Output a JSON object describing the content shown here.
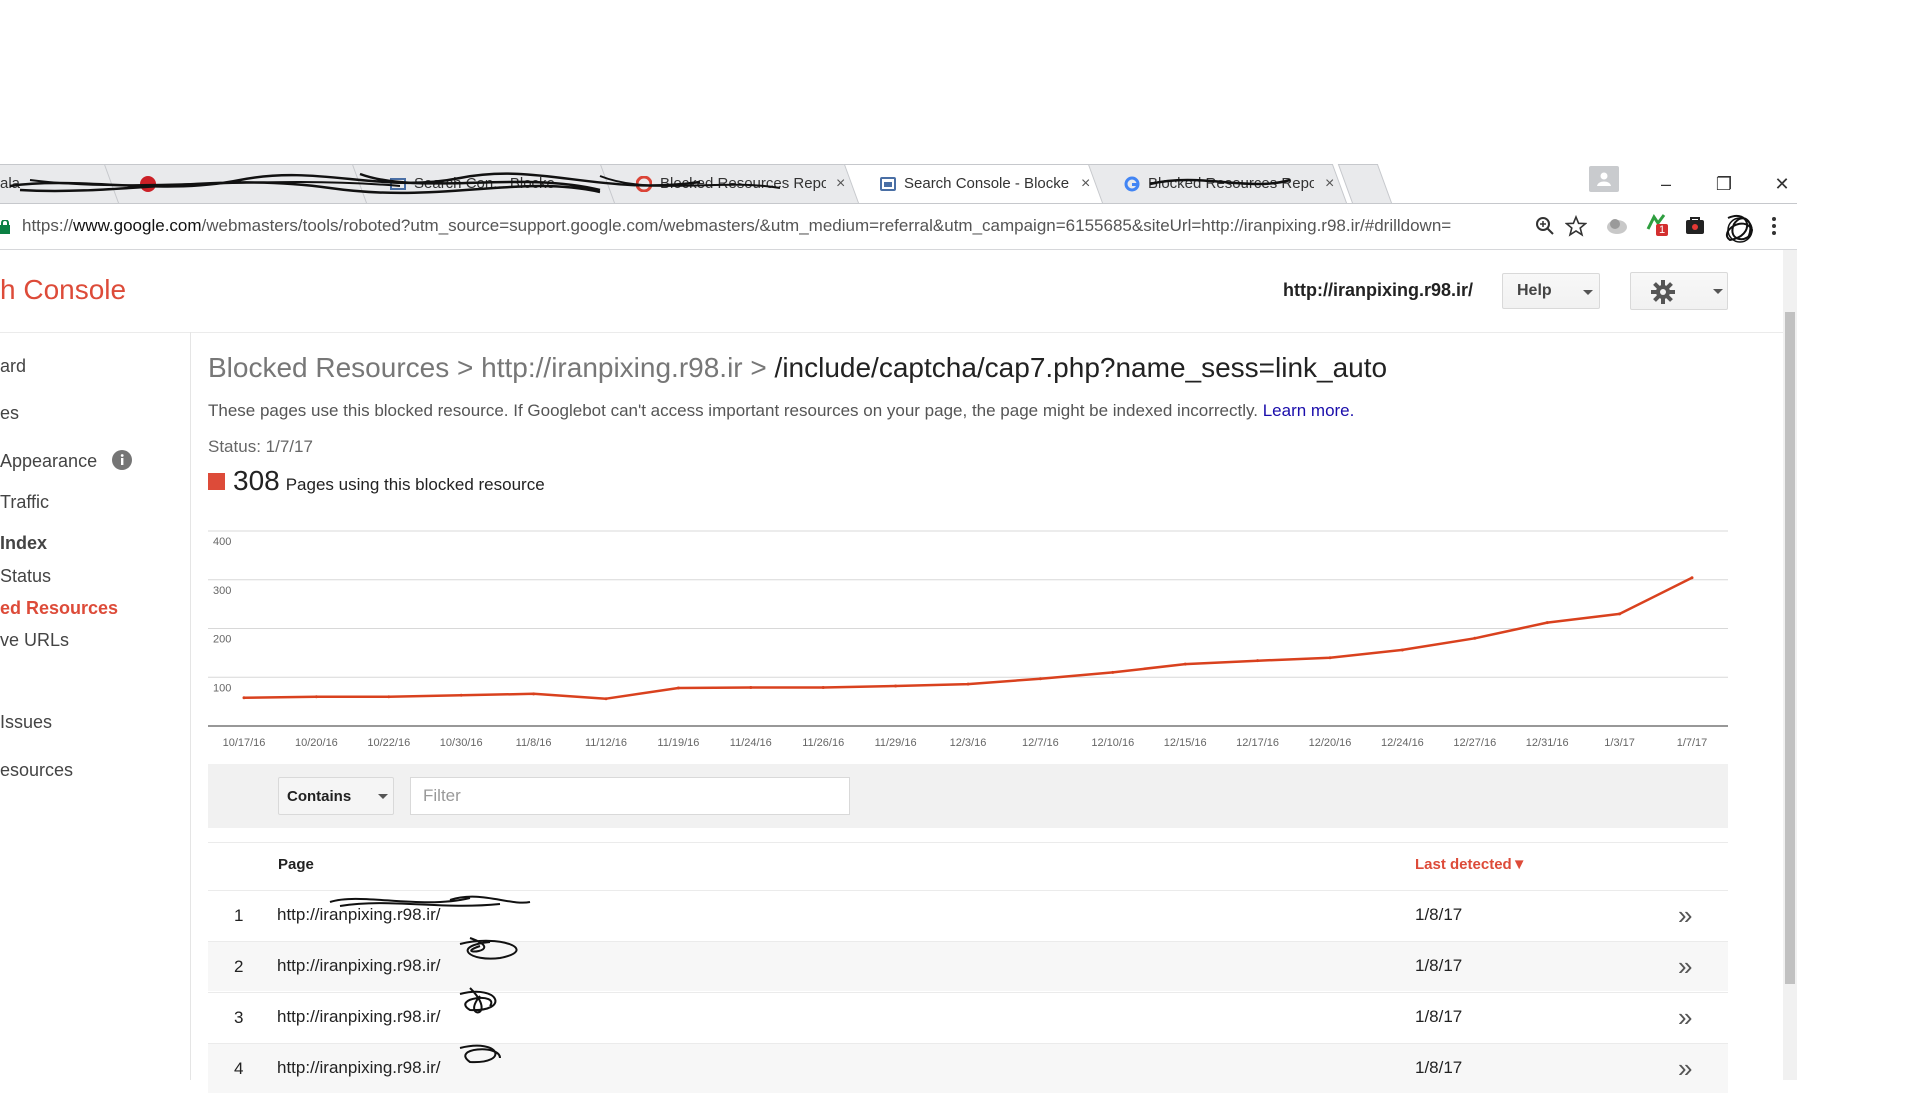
{
  "browser": {
    "tabs": [
      {
        "title": "ala",
        "close": "×"
      },
      {
        "title": "",
        "close": "×"
      },
      {
        "title": "Search Con... Blocke",
        "close": "×"
      },
      {
        "title": "Blocked Resources Repo",
        "close": "×"
      },
      {
        "title": "Search Console - Blocke",
        "close": "×"
      },
      {
        "title": "Blocked Resources Repo",
        "close": "×"
      }
    ],
    "url_scheme": "https://",
    "url_host": "www.google.com",
    "url_path": "/webmasters/tools/roboted?utm_source=support.google.com/webmasters/&utm_medium=referral&utm_campaign=6155685&siteUrl=http://iranpixing.r98.ir/#drilldown=",
    "extension_badge": "1",
    "window_controls": {
      "minimize": "–",
      "maximize": "❐",
      "close": "✕"
    }
  },
  "header": {
    "app_title": "h Console",
    "site_url": "http://iranpixing.r98.ir/",
    "help_label": "Help"
  },
  "sidenav": {
    "items": [
      {
        "label": "ard"
      },
      {
        "label": "es"
      },
      {
        "label": "Appearance"
      },
      {
        "label": "Traffic"
      },
      {
        "label": "Index"
      },
      {
        "label": "Status"
      },
      {
        "label": "ed Resources"
      },
      {
        "label": "ve URLs"
      },
      {
        "label": " Issues"
      },
      {
        "label": "esources"
      }
    ]
  },
  "main": {
    "breadcrumb": {
      "part1": "Blocked Resources",
      "sep": " > ",
      "part2": "http://iranpixing.r98.ir",
      "part3": "/include/captcha/cap7.php?name_sess=link_auto"
    },
    "description": "These pages use this blocked resource. If Googlebot can't access important resources on your page, the page might be indexed incorrectly.",
    "learn_more": "Learn more.",
    "status": "Status: 1/7/17",
    "metric_count": "308",
    "metric_label": "Pages using this blocked resource",
    "filter": {
      "mode": "Contains",
      "placeholder": "Filter"
    },
    "table": {
      "columns": {
        "page": "Page",
        "last_detected": "Last detected▼"
      },
      "rows": [
        {
          "num": "1",
          "page": "http://iranpixing.r98.ir/",
          "date": "1/8/17",
          "go": "»"
        },
        {
          "num": "2",
          "page": "http://iranpixing.r98.ir/",
          "date": "1/8/17",
          "go": "»"
        },
        {
          "num": "3",
          "page": "http://iranpixing.r98.ir/",
          "date": "1/8/17",
          "go": "»"
        },
        {
          "num": "4",
          "page": "http://iranpixing.r98.ir/",
          "date": "1/8/17",
          "go": "»"
        }
      ]
    }
  },
  "colors": {
    "accent": "#dd4b39",
    "link": "#1a0dab",
    "series": "#d9411e"
  },
  "chart_data": {
    "type": "line",
    "x": [
      "10/17/16",
      "10/20/16",
      "10/22/16",
      "10/30/16",
      "11/8/16",
      "11/12/16",
      "11/19/16",
      "11/24/16",
      "11/26/16",
      "11/29/16",
      "12/3/16",
      "12/7/16",
      "12/10/16",
      "12/15/16",
      "12/17/16",
      "12/20/16",
      "12/24/16",
      "12/27/16",
      "12/31/16",
      "1/3/17",
      "1/7/17"
    ],
    "series": [
      {
        "values": [
          58,
          60,
          60,
          63,
          66,
          56,
          78,
          79,
          79,
          82,
          86,
          97,
          110,
          127,
          134,
          140,
          156,
          180,
          212,
          230,
          304
        ]
      }
    ],
    "ylim": [
      0,
      400
    ],
    "yticks": [
      "100",
      "200",
      "300",
      "400"
    ],
    "grid": true
  }
}
